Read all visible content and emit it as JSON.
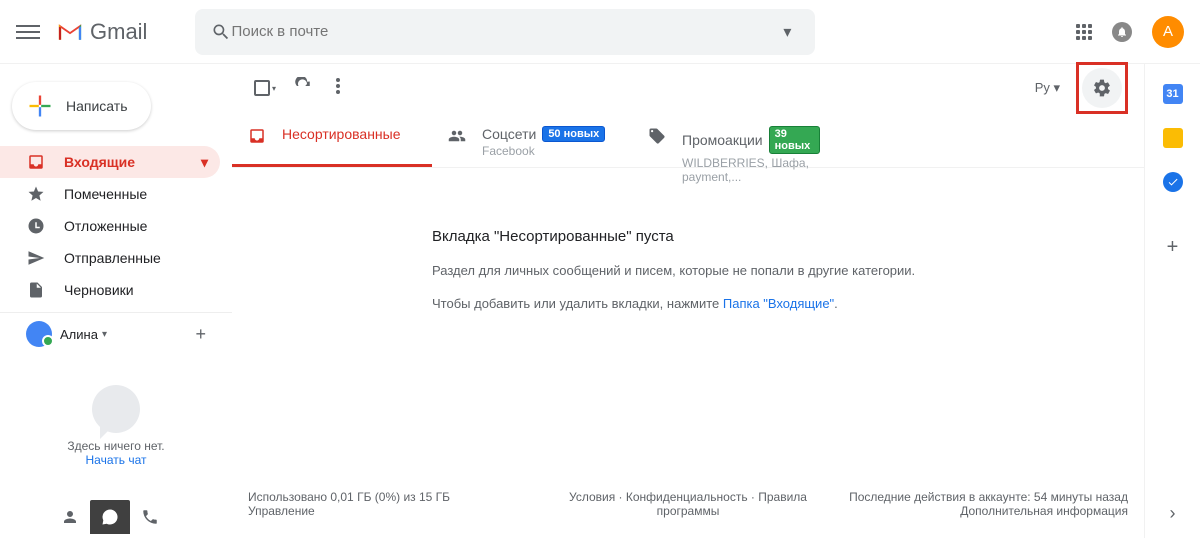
{
  "header": {
    "gmail_text": "Gmail",
    "search_placeholder": "Поиск в почте",
    "avatar_letter": "А"
  },
  "compose_label": "Написать",
  "nav": {
    "inbox": "Входящие",
    "starred": "Помеченные",
    "snoozed": "Отложенные",
    "sent": "Отправленные",
    "drafts": "Черновики"
  },
  "hangouts": {
    "user_name": "Алина",
    "empty_text": "Здесь ничего нет.",
    "start_chat": "Начать чат"
  },
  "toolbar": {
    "lang": "Ру"
  },
  "tabs": {
    "primary": "Несортированные",
    "social": "Соцсети",
    "social_badge": "50 новых",
    "social_sub": "Facebook",
    "promo": "Промоакции",
    "promo_badge": "39 новых",
    "promo_sub": "WILDBERRIES, Шафа, payment,..."
  },
  "empty": {
    "title": "Вкладка \"Несортированные\" пуста",
    "text": "Раздел для личных сообщений и писем, которые не попали в другие категории.",
    "config_prefix": "Чтобы добавить или удалить вкладки, нажмите ",
    "config_link": "Папка \"Входящие\"",
    "config_suffix": "."
  },
  "footer": {
    "storage": "Использовано 0,01 ГБ (0%) из 15 ГБ",
    "manage": "Управление",
    "terms": "Условия · Конфиденциальность · Правила программы",
    "activity": "Последние действия в аккаунте: 54 минуты назад",
    "details": "Дополнительная информация"
  },
  "rail": {
    "cal": "31"
  }
}
